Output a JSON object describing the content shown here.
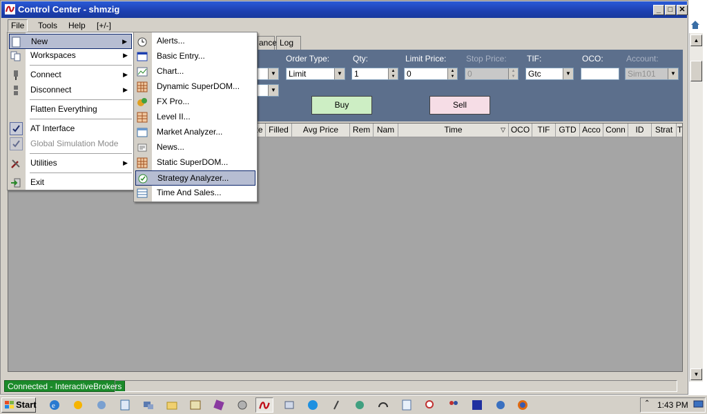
{
  "window": {
    "title": "Control Center - shmzig"
  },
  "menubar": {
    "file": "File",
    "tools": "Tools",
    "help": "Help",
    "expand": "[+/-]"
  },
  "tabs": {
    "balance": "ance",
    "log": "Log"
  },
  "order": {
    "order_type_label": "Order Type:",
    "order_type_value": "Limit",
    "qty_label": "Qty:",
    "qty_value": "1",
    "limit_label": "Limit Price:",
    "limit_value": "0",
    "stop_label": "Stop Price:",
    "stop_value": "0",
    "tif_label": "TIF:",
    "tif_value": "Gtc",
    "oco_label": "OCO:",
    "oco_value": "",
    "account_label": "Account:",
    "account_value": "Sim101",
    "buy": "Buy",
    "sell": "Sell"
  },
  "grid": {
    "columns": [
      "te",
      "Filled",
      "Avg Price",
      "Rem",
      "Nam",
      "Time",
      "OCO",
      "TIF",
      "GTD",
      "Acco",
      "Conn",
      "ID",
      "Strat",
      "T"
    ]
  },
  "file_menu": {
    "items": [
      {
        "label": "New",
        "icon": "new-icon"
      },
      {
        "label": "Workspaces",
        "icon": "workspaces-icon"
      },
      {
        "label": "Connect",
        "icon": "connect-icon"
      },
      {
        "label": "Disconnect",
        "icon": "disconnect-icon"
      },
      {
        "label": "Flatten Everything"
      },
      {
        "label": "AT Interface",
        "checked": true
      },
      {
        "label": "Global Simulation Mode",
        "checked": true,
        "disabled": true
      },
      {
        "label": "Utilities",
        "icon": "utilities-icon"
      },
      {
        "label": "Exit",
        "icon": "exit-icon"
      }
    ]
  },
  "new_menu": {
    "items": [
      {
        "label": "Alerts...",
        "icon": "alarm-clock-icon"
      },
      {
        "label": "Basic Entry...",
        "icon": "basic-entry-icon"
      },
      {
        "label": "Chart...",
        "icon": "chart-icon"
      },
      {
        "label": "Dynamic SuperDOM...",
        "icon": "superdom-icon"
      },
      {
        "label": "FX Pro...",
        "icon": "fx-pro-icon"
      },
      {
        "label": "Level II...",
        "icon": "level-ii-icon"
      },
      {
        "label": "Market Analyzer...",
        "icon": "market-analyzer-icon"
      },
      {
        "label": "News...",
        "icon": "news-icon"
      },
      {
        "label": "Static SuperDOM...",
        "icon": "superdom-icon"
      },
      {
        "label": "Strategy Analyzer...",
        "icon": "strategy-analyzer-icon"
      },
      {
        "label": "Time And Sales...",
        "icon": "time-and-sales-icon"
      }
    ]
  },
  "status": {
    "connection": "Connected - InteractiveBrokers"
  },
  "taskbar": {
    "start": "Start",
    "clock": "1:43 PM"
  },
  "colors": {
    "title_blue": "#1c3fb0",
    "panel": "#5c6f8c",
    "buy": "#cdeec4",
    "sell": "#f6dde6",
    "connected": "#1b8a2a",
    "menu_highlight": "#b6bdd2"
  }
}
